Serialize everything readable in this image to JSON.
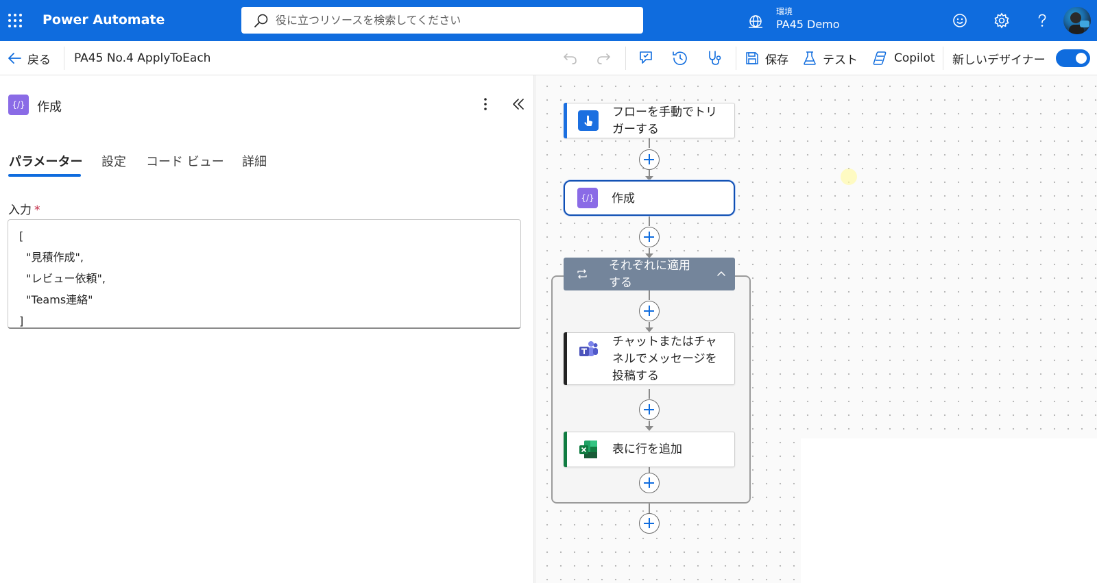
{
  "topbar": {
    "app_name": "Power Automate",
    "search_placeholder": "役に立つリソースを検索してください",
    "environment_label": "環境",
    "environment_name": "PA45 Demo"
  },
  "command_bar": {
    "back_label": "戻る",
    "flow_name": "PA45 No.4 ApplyToEach",
    "save_label": "保存",
    "test_label": "テスト",
    "copilot_label": "Copilot",
    "new_designer_label": "新しいデザイナー",
    "new_designer_on": true
  },
  "panel": {
    "title": "作成",
    "tabs": [
      {
        "label": "パラメーター",
        "active": true
      },
      {
        "label": "設定",
        "active": false
      },
      {
        "label": "コード ビュー",
        "active": false
      },
      {
        "label": "詳細",
        "active": false
      }
    ],
    "input_label": "入力",
    "required_mark": "*",
    "input_lines": [
      "[",
      "  \"見積作成\",",
      "  \"レビュー依頼\",",
      "  \"Teams連絡\"",
      "]"
    ]
  },
  "flow": {
    "trigger": {
      "label": "フローを手動でトリガーする",
      "line1": "フローを手動でトリ",
      "line2": "ガーする",
      "icon": "touch-icon",
      "color": "#1b6fe0"
    },
    "compose": {
      "label": "作成",
      "icon": "compose-icon",
      "color": "#8a6be6"
    },
    "loop": {
      "label": "それぞれに適用する",
      "line1": "それぞれに適用",
      "line2": "する",
      "icon": "loop-icon",
      "color": "#74859b"
    },
    "teams": {
      "label": "チャットまたはチャネルでメッセージを投稿する",
      "line1": "チャットまたはチャ",
      "line2": "ネルでメッセージを",
      "line3": "投稿する",
      "icon": "teams-icon",
      "color": "#232323"
    },
    "excel": {
      "label": "表に行を追加",
      "icon": "excel-icon",
      "color": "#107c41"
    }
  },
  "colors": {
    "brand": "#0f6cde",
    "accent_selected": "#0f4fb3"
  }
}
